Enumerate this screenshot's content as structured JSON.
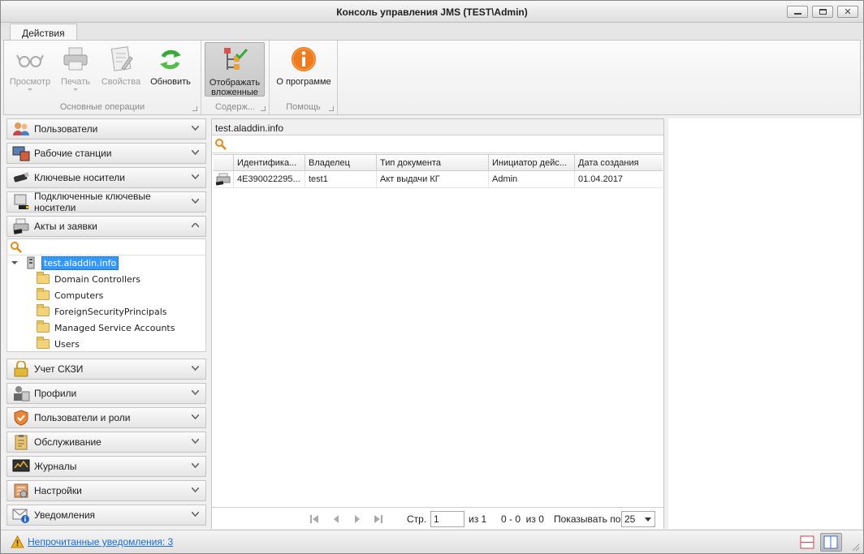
{
  "window": {
    "title": "Консоль управления JMS (TEST\\Admin)"
  },
  "ribbon": {
    "tab": "Действия",
    "groups": {
      "main": "Основные операции",
      "content": "Содерж...",
      "help": "Помощь"
    },
    "buttons": {
      "view": "Просмотр",
      "print": "Печать",
      "properties": "Свойства",
      "refresh": "Обновить",
      "show_nested_1": "Отображать",
      "show_nested_2": "вложенные",
      "about": "О программе"
    }
  },
  "nav": {
    "users": "Пользователи",
    "workstations": "Рабочие станции",
    "key_media": "Ключевые носители",
    "connected_media": "Подключенные ключевые носители",
    "acts": "Акты и заявки",
    "skzi": "Учет СКЗИ",
    "profiles": "Профили",
    "users_roles": "Пользователи и роли",
    "maintenance": "Обслуживание",
    "journals": "Журналы",
    "settings": "Настройки",
    "notifications": "Уведомления"
  },
  "tree": {
    "root": "test.aladdin.info",
    "children": [
      "Domain Controllers",
      "Computers",
      "ForeignSecurityPrincipals",
      "Managed Service Accounts",
      "Users"
    ]
  },
  "content": {
    "breadcrumb": "test.aladdin.info",
    "columns": [
      "Идентифика...",
      "Владелец",
      "Тип документа",
      "Инициатор дейс...",
      "Дата создания"
    ],
    "rows": [
      {
        "id": "4E390022295...",
        "owner": "test1",
        "type": "Акт выдачи КГ",
        "initiator": "Admin",
        "date": "01.04.2017"
      }
    ]
  },
  "pager": {
    "page_label": "Стр.",
    "page_value": "1",
    "of_pages": "из 1",
    "range": "0 - 0  из 0",
    "show_label": "Показывать по",
    "page_size": "25"
  },
  "status": {
    "unread": "Непрочитанные уведомления: 3"
  },
  "colors": {
    "accent": "#1a6fd0",
    "selection": "#3399ff",
    "about_icon": "#f07a1e",
    "refresh_icon": "#3aa83a"
  }
}
